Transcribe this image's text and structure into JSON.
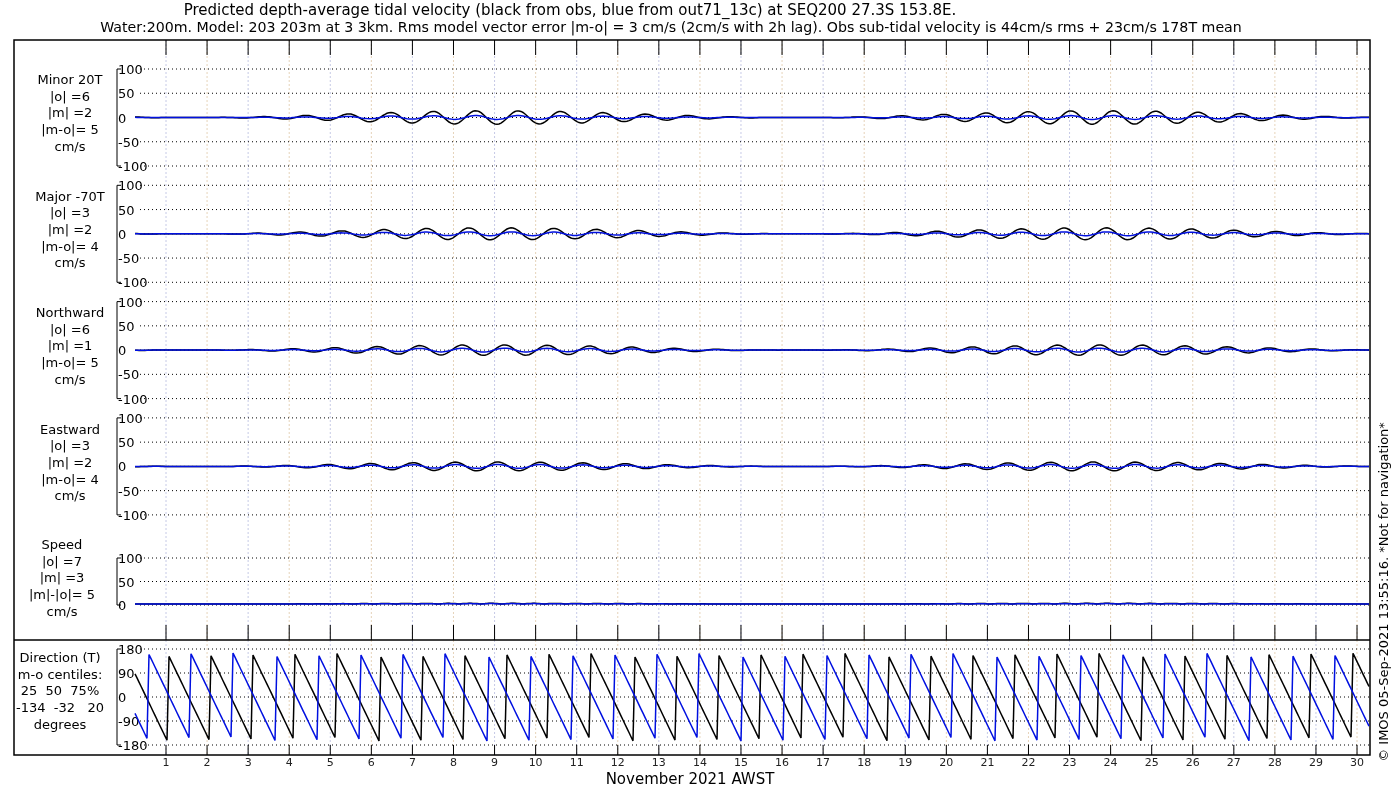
{
  "title": {
    "lines": [
      "Predicted depth-average tidal velocity (black from obs, blue from out71_13c) at SEQ200 27.3S 153.8E.",
      "Water:200m. Model: 203 203m at 3 3km. Rms model vector error |m-o| = 3 cm/s (2cm/s with 2h lag). Obs sub-tidal velocity is 44cm/s rms + 23cm/s 178T mean"
    ]
  },
  "panels": [
    {
      "kind": "velocity",
      "label_lines": [
        "Minor 20T",
        "|o| =6",
        "|m| =2",
        "|m-o|= 5",
        "cm/s"
      ],
      "yticks": [
        "100",
        "50",
        "0",
        "-50",
        "-100"
      ]
    },
    {
      "kind": "velocity",
      "label_lines": [
        "Major -70T",
        "|o| =3",
        "|m| =2",
        "|m-o|= 4",
        "cm/s"
      ],
      "yticks": [
        "100",
        "50",
        "0",
        "-50",
        "-100"
      ]
    },
    {
      "kind": "velocity",
      "label_lines": [
        "Northward",
        "|o| =6",
        "|m| =1",
        "|m-o|= 5",
        "cm/s"
      ],
      "yticks": [
        "100",
        "50",
        "0",
        "-50",
        "-100"
      ]
    },
    {
      "kind": "velocity",
      "label_lines": [
        "Eastward",
        "|o| =3",
        "|m| =2",
        "|m-o|= 4",
        "cm/s"
      ],
      "yticks": [
        "100",
        "50",
        "0",
        "-50",
        "-100"
      ]
    },
    {
      "kind": "speed",
      "label_lines": [
        "Speed",
        "|o| =7",
        "|m| =3",
        "|m|-|o|= 5",
        "cm/s"
      ],
      "yticks": [
        "100",
        "50",
        "0"
      ]
    },
    {
      "kind": "direction",
      "label_lines": [
        "Direction (T)",
        "m-o centiles:",
        "25  50  75%",
        "-134  -32   20",
        "degrees"
      ],
      "yticks": [
        "180",
        "90",
        "0",
        "-90",
        "-180"
      ]
    }
  ],
  "xaxis": {
    "ticks": [
      "1",
      "2",
      "3",
      "4",
      "5",
      "6",
      "7",
      "8",
      "9",
      "10",
      "11",
      "12",
      "13",
      "14",
      "15",
      "16",
      "17",
      "18",
      "19",
      "20",
      "21",
      "22",
      "23",
      "24",
      "25",
      "26",
      "27",
      "28",
      "29",
      "30"
    ],
    "label": "November 2021 AWST"
  },
  "credit": "© IMOS 05-Sep-2021 13:55:16. *Not for navigation*"
}
